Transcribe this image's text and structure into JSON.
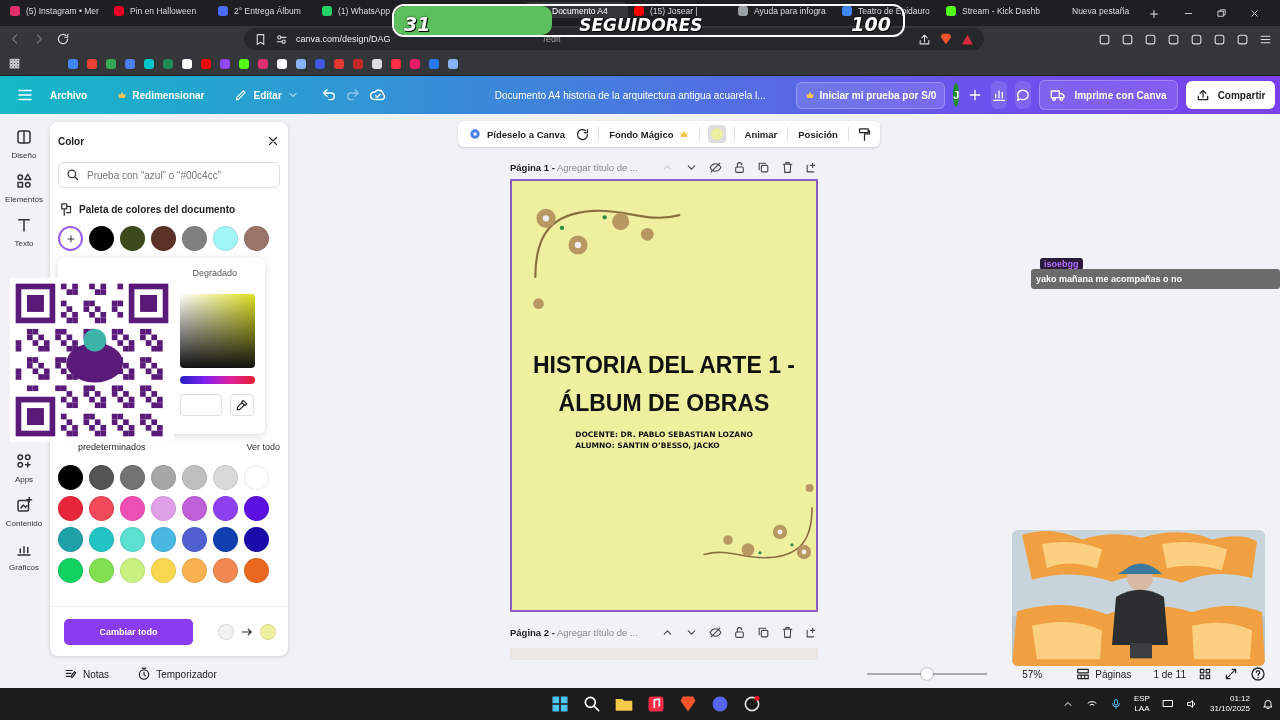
{
  "browser": {
    "tabs": [
      {
        "label": "(5) Instagram • Mer",
        "color": "#e1306c",
        "selected": false
      },
      {
        "label": "Pin en Halloween",
        "color": "#e60023",
        "selected": false
      },
      {
        "label": "2° Entrega Álbum",
        "color": "#4a6cf7",
        "selected": false
      },
      {
        "label": "(1) WhatsApp",
        "color": "#25d366",
        "selected": false
      },
      {
        "label": "Documento A4",
        "selected": true
      },
      {
        "label": "(15) Josear |",
        "color": "#ff0000",
        "selected": false
      },
      {
        "label": "Ayuda para infogra",
        "color": "#9aa0a6",
        "selected": false
      },
      {
        "label": "Teatro de Epidauro",
        "color": "#4285f4",
        "selected": false
      },
      {
        "label": "Stream - Kick Dashb",
        "color": "#53fc18",
        "selected": false
      },
      {
        "label": "Nueva pestaña",
        "selected": false
      }
    ],
    "url": "canva.com/design/DAG",
    "url_end": "/edit",
    "bookmarks": [
      {
        "color": "#4285f4"
      },
      {
        "color": "#ea4335"
      },
      {
        "color": "#34a853"
      },
      {
        "color": "#4a7ef0"
      },
      {
        "color": "#00c4cc"
      },
      {
        "color": "#1f8a4c"
      },
      {
        "color": "#ffffff"
      },
      {
        "color": "#ff0000"
      },
      {
        "color": "#9146ff"
      },
      {
        "color": "#53fc18"
      },
      {
        "color": "#e1306c"
      },
      {
        "color": "#ffffff"
      },
      {
        "color": "#8ab4f8"
      },
      {
        "color": "#3b5bdb"
      },
      {
        "color": "#e53935"
      },
      {
        "color": "#c62828"
      },
      {
        "color": "#dddddd"
      },
      {
        "color": "#fa2d48"
      },
      {
        "color": "#e91e63"
      },
      {
        "color": "#2979ff"
      },
      {
        "color": "#8ab4f8"
      }
    ]
  },
  "header": {
    "menu": [
      "Archivo",
      "Redimensionar",
      "Editar"
    ],
    "title": "Documento A4 historia de la arquitectura antigua acuarela l...",
    "trial": "Iniciar mi prueba por S/0",
    "avatar": "J",
    "print": "Imprime con Canva",
    "share": "Compartir"
  },
  "rail": [
    {
      "label": "Diseño",
      "kind": "layout"
    },
    {
      "label": "Elementos",
      "kind": "shapes"
    },
    {
      "label": "Texto",
      "kind": "text"
    },
    {
      "label": "Apps",
      "kind": "apps"
    },
    {
      "label": "Contenido",
      "kind": "upload"
    },
    {
      "label": "Gráficos",
      "kind": "chart"
    }
  ],
  "color_panel": {
    "title": "Color",
    "search_placeholder": "Prueba con “azul” o “#00c4cc”",
    "document_heading": "Paleta de colores del documento",
    "document_colors": [
      {
        "color": "#000000"
      },
      {
        "color": "#3d4a1c"
      },
      {
        "color": "#5c3228"
      },
      {
        "color": "#808080"
      },
      {
        "color": "#a0f5f5"
      },
      {
        "color": "#9a7468"
      }
    ],
    "picker_tabs": [
      {
        "label": "Degradado",
        "selected": false
      }
    ],
    "defaults_heading": "predeterminados",
    "see_all": "Ver todo",
    "default_colors": [
      {
        "color": "#000000"
      },
      {
        "color": "#545454"
      },
      {
        "color": "#737373"
      },
      {
        "color": "#a6a6a6"
      },
      {
        "color": "#bfbfbf"
      },
      {
        "color": "#d9d9d9"
      },
      {
        "color": "#ffffff"
      },
      {
        "color": "#e8263a"
      },
      {
        "color": "#f04a5a"
      },
      {
        "color": "#ee4fb4"
      },
      {
        "color": "#e0a0e8"
      },
      {
        "color": "#c060d8"
      },
      {
        "color": "#8c40f0"
      },
      {
        "color": "#5b10e0"
      },
      {
        "color": "#20a0a8"
      },
      {
        "color": "#22c4c4"
      },
      {
        "color": "#5ce0d0"
      },
      {
        "color": "#48b8e0"
      },
      {
        "color": "#5060d0"
      },
      {
        "color": "#1040b0"
      },
      {
        "color": "#1a0aa8"
      },
      {
        "color": "#10d060"
      },
      {
        "color": "#80e050"
      },
      {
        "color": "#c8f080"
      },
      {
        "color": "#f8d850"
      },
      {
        "color": "#f8b050"
      },
      {
        "color": "#f08850"
      },
      {
        "color": "#e86820"
      }
    ],
    "apply_button": "Cambiar todo",
    "replace": [
      {
        "color": "#f2f2f2"
      },
      {
        "color": "#eef0a0"
      }
    ]
  },
  "context_toolbar": {
    "ask": "Pídeselo a Canva",
    "magic": "Fondo Mágico",
    "animate": "Animar",
    "position": "Posición"
  },
  "pages": [
    {
      "label": "Página 1 -",
      "title_placeholder": "Agregar título de ..."
    },
    {
      "label": "Página 2 -",
      "title_placeholder": "Agregar título de ..."
    }
  ],
  "document": {
    "title": "HISTORIA DEL ARTE 1 - ÁLBUM DE OBRAS",
    "lines": [
      "DOCENTE: DR. PABLO SEBASTIAN LOZANO",
      "ALUMNO: SANTIN O’BESSO, JACKO"
    ]
  },
  "footer": {
    "notes": "Notas",
    "timer": "Temporizador",
    "zoom": {
      "level": 0.5
    },
    "zoom_reading": "57%",
    "pages": "Páginas",
    "page_count": "1 de 11"
  },
  "taskbar": {
    "lang": "ESP",
    "layout": "LAA",
    "time": "01:12",
    "date": "31/10/2025"
  },
  "stream_overlay": {
    "goal": {
      "current": "31",
      "label": "SEGUIDORES",
      "target": "100",
      "level": 0.31
    },
    "chat": {
      "user": "isoebgg",
      "message": "yako mañana me acompañas o no"
    }
  }
}
